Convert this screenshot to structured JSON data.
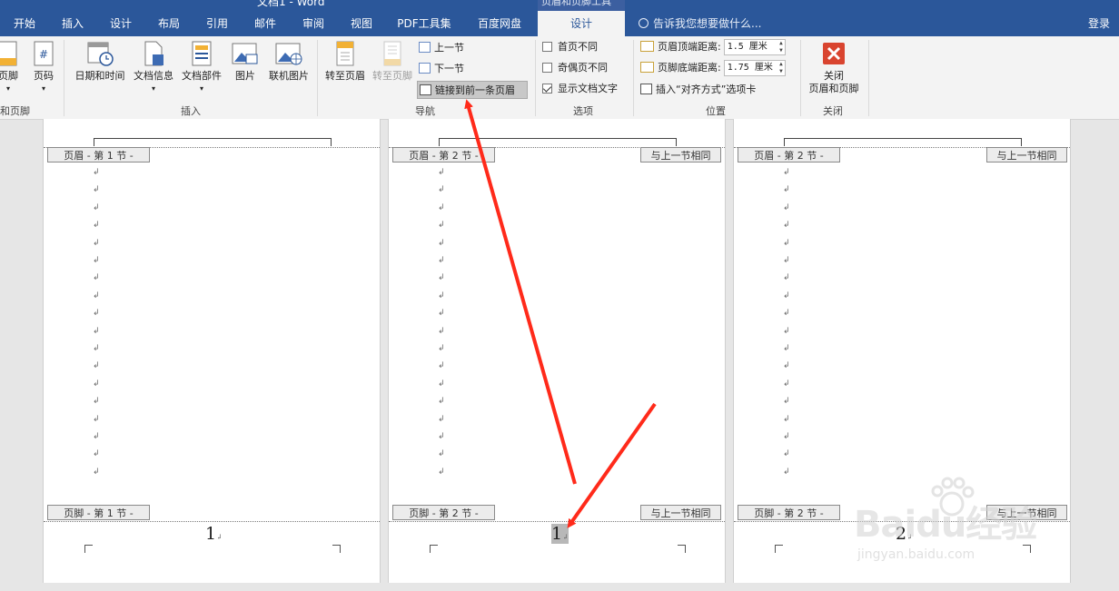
{
  "window": {
    "title": "文档1 - Word",
    "context_group": "页眉和页脚工具",
    "login": "登录"
  },
  "tabs": [
    "开始",
    "插入",
    "设计",
    "布局",
    "引用",
    "邮件",
    "审阅",
    "视图",
    "PDF工具集",
    "百度网盘"
  ],
  "active_tab": "设计",
  "tell_me": "告诉我您想要做什么...",
  "ribbon": {
    "hf_group": {
      "footer": "页脚",
      "page_number": "页码",
      "label": "和页脚"
    },
    "insert_group": {
      "buttons": [
        "日期和时间",
        "文档信息",
        "文档部件",
        "图片",
        "联机图片"
      ],
      "label": "插入"
    },
    "nav_group": {
      "goto_header": "转至页眉",
      "goto_footer": "转至页脚",
      "prev_section": "上一节",
      "next_section": "下一节",
      "link_previous": "链接到前一条页眉",
      "label": "导航"
    },
    "options_group": {
      "first_page": "首页不同",
      "odd_even": "奇偶页不同",
      "show_text": "显示文档文字",
      "show_text_checked": true,
      "label": "选项"
    },
    "position_group": {
      "header_top": "页眉顶端距离:",
      "header_top_value": "1.5 厘米",
      "footer_bottom": "页脚底端距离:",
      "footer_bottom_value": "1.75 厘米",
      "align_tab": "插入“对齐方式”选项卡",
      "label": "位置"
    },
    "close_group": {
      "close_line1": "关闭",
      "close_line2": "页眉和页脚",
      "label": "关闭"
    }
  },
  "pages": [
    {
      "header_tag": "页眉 - 第 1 节 -",
      "footer_tag": "页脚 - 第 1 节 -",
      "same_as_prev": "",
      "page_number": "1"
    },
    {
      "header_tag": "页眉 - 第 2 节 -",
      "footer_tag": "页脚 - 第 2 节 -",
      "same_as_prev": "与上一节相同",
      "page_number": "1"
    },
    {
      "header_tag": "页眉 - 第 2 节 -",
      "footer_tag": "页脚 - 第 2 节 -",
      "same_as_prev": "与上一节相同",
      "page_number": "2"
    }
  ],
  "paragraph_mark": "↲",
  "watermark": {
    "brand": "Baidu经验",
    "url": "jingyan.baidu.com"
  },
  "colors": {
    "title_bar": "#2b579a",
    "ribbon": "#f3f3f3",
    "arrow": "#ff2a1a",
    "close_red": "#d9442f"
  }
}
